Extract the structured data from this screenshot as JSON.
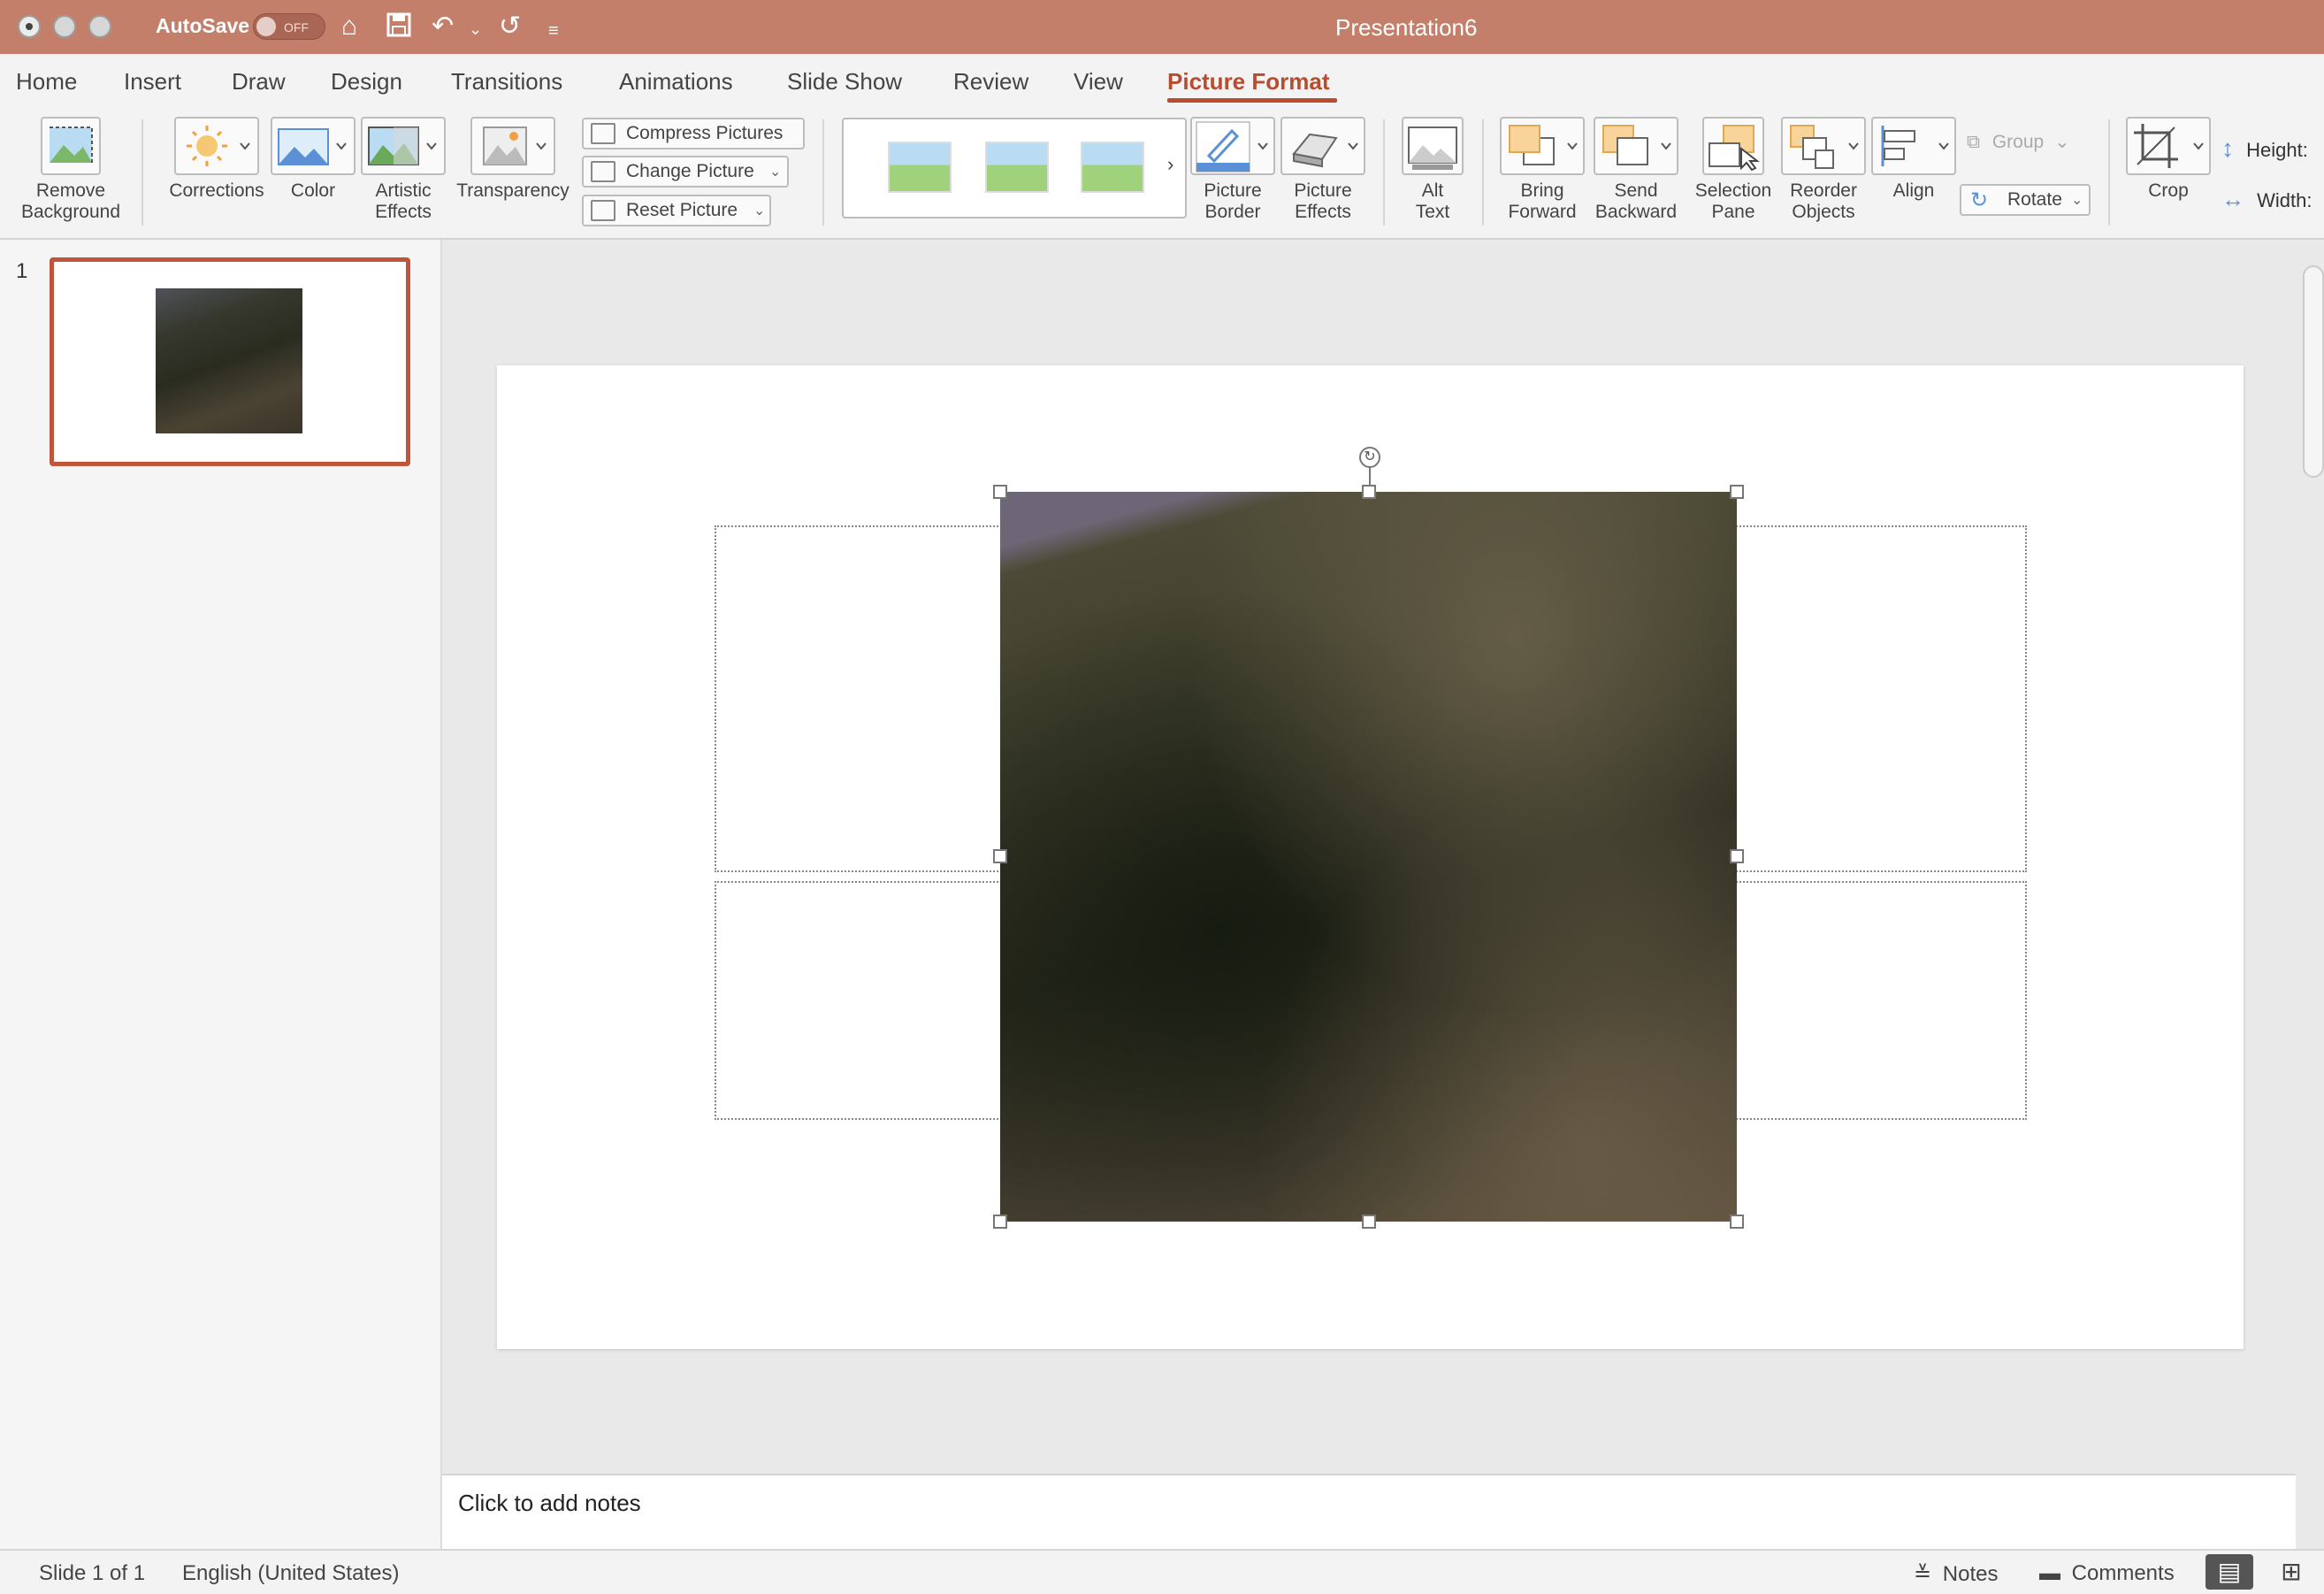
{
  "window": {
    "title": "Presentation6",
    "autosave_label": "AutoSave",
    "autosave_state": "OFF"
  },
  "tabs": [
    "Home",
    "Insert",
    "Draw",
    "Design",
    "Transitions",
    "Animations",
    "Slide Show",
    "Review",
    "View",
    "Picture Format"
  ],
  "active_tab": "Picture Format",
  "ribbon": {
    "remove_background": [
      "Remove",
      "Background"
    ],
    "corrections": "Corrections",
    "color": "Color",
    "artistic_effects": [
      "Artistic",
      "Effects"
    ],
    "transparency": "Transparency",
    "compress_pictures": "Compress Pictures",
    "change_picture": "Change Picture",
    "reset_picture": "Reset Picture",
    "picture_border": [
      "Picture",
      "Border"
    ],
    "picture_effects": [
      "Picture",
      "Effects"
    ],
    "alt_text": [
      "Alt",
      "Text"
    ],
    "bring_forward": [
      "Bring",
      "Forward"
    ],
    "send_backward": [
      "Send",
      "Backward"
    ],
    "selection_pane": [
      "Selection",
      "Pane"
    ],
    "reorder_objects": [
      "Reorder",
      "Objects"
    ],
    "align": "Align",
    "group": "Group",
    "rotate": "Rotate",
    "crop": "Crop",
    "height_label": "Height:",
    "width_label": "Width:"
  },
  "slides_pane": {
    "slide_number": "1"
  },
  "notes": {
    "placeholder": "Click to add notes"
  },
  "status": {
    "slide_info": "Slide 1 of 1",
    "language": "English (United States)",
    "notes_label": "Notes",
    "comments_label": "Comments"
  },
  "colors": {
    "title_bar": "#c47f6b",
    "accent": "#b94b2e"
  }
}
